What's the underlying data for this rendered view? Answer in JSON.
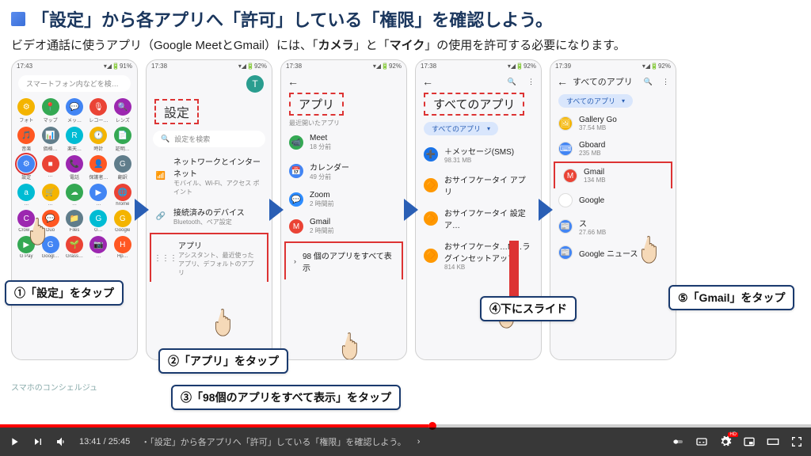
{
  "title": "「設定」から各アプリへ「許可」している「権限」を確認しよう。",
  "subtitle_pre": "ビデオ通話に使うアプリ（Google MeetとGmail）には、「",
  "subtitle_b1": "カメラ",
  "subtitle_mid": "」と「",
  "subtitle_b2": "マイク",
  "subtitle_post": "」の使用を許可する必要になります。",
  "callouts": {
    "c1": "①「設定」をタップ",
    "c2": "②「アプリ」をタップ",
    "c3": "③「98個のアプリをすべて表示」をタップ",
    "c4": "④下にスライド",
    "c5": "⑤「Gmail」をタップ"
  },
  "phone1": {
    "time": "17:43",
    "battery": "91%",
    "search_placeholder": "スマートフォン内などを検…",
    "apps": [
      {
        "i": "⚙",
        "l": "フォト"
      },
      {
        "i": "📍",
        "l": "マップ"
      },
      {
        "i": "💬",
        "l": "メッ…"
      },
      {
        "i": "🎙",
        "l": "レコー…"
      },
      {
        "i": "🔍",
        "l": "レンズ"
      },
      {
        "i": "🎵",
        "l": "音楽"
      },
      {
        "i": "📊",
        "l": "価格…"
      },
      {
        "i": "R",
        "l": "楽天…"
      },
      {
        "i": "🕐",
        "l": "時計"
      },
      {
        "i": "📄",
        "l": "証明…"
      },
      {
        "i": "⚙",
        "l": "設定"
      },
      {
        "i": "■",
        "l": "… "
      },
      {
        "i": "📞",
        "l": "電話"
      },
      {
        "i": "👤",
        "l": "保護者…"
      },
      {
        "i": "G",
        "l": "翻訳"
      },
      {
        "i": "a",
        "l": "… "
      },
      {
        "i": "🛒",
        "l": "…"
      },
      {
        "i": "☁",
        "l": "…"
      },
      {
        "i": "▶",
        "l": "…"
      },
      {
        "i": "🌐",
        "l": "hrome"
      },
      {
        "i": "C",
        "l": "Crow…"
      },
      {
        "i": "💬",
        "l": "Duo"
      },
      {
        "i": "📁",
        "l": "Files"
      },
      {
        "i": "G",
        "l": "G…"
      },
      {
        "i": "G",
        "l": "Google"
      },
      {
        "i": "▶",
        "l": "G Pay"
      },
      {
        "i": "G",
        "l": "Googl…"
      },
      {
        "i": "🌱",
        "l": "Grass…"
      },
      {
        "i": "📷",
        "l": "…"
      },
      {
        "i": "H",
        "l": "Hp…"
      }
    ]
  },
  "phone2": {
    "time": "17:38",
    "battery": "92%",
    "title": "設定",
    "search": "設定を検索",
    "items": [
      {
        "icon": "📶",
        "main": "ネットワークとインターネット",
        "sub": "モバイル、Wi-Fi、アクセス ポイント"
      },
      {
        "icon": "🔗",
        "main": "接続済みのデバイス",
        "sub": "Bluetooth、ペア設定"
      },
      {
        "icon": "⋮⋮⋮",
        "main": "アプリ",
        "sub": "アシスタント、最近使ったアプリ、デフォルトのアプリ"
      }
    ]
  },
  "phone3": {
    "time": "17:38",
    "battery": "92%",
    "title": "アプリ",
    "section": "最近開いたアプリ",
    "items": [
      {
        "icon": "📹",
        "bg": "#34a853",
        "main": "Meet",
        "sub": "18 分前"
      },
      {
        "icon": "📅",
        "bg": "#4285f4",
        "main": "カレンダー",
        "sub": "49 分前"
      },
      {
        "icon": "💬",
        "bg": "#2d8cff",
        "main": "Zoom",
        "sub": "2 時間前"
      },
      {
        "icon": "M",
        "bg": "#ea4335",
        "main": "Gmail",
        "sub": "2 時間前"
      }
    ],
    "showall": "98 個のアプリをすべて表示"
  },
  "phone4": {
    "time": "17:38",
    "battery": "92%",
    "title": "すべてのアプリ",
    "filter": "すべてのアプリ",
    "items": [
      {
        "icon": "➕",
        "bg": "#1a73e8",
        "main": "＋メッセージ(SMS)",
        "sub": "98.31 MB"
      },
      {
        "icon": "🔶",
        "bg": "#ff9800",
        "main": "おサイフケータイ アプリ",
        "sub": ""
      },
      {
        "icon": "🔶",
        "bg": "#ff9800",
        "main": "おサイフケータイ 設定ア…",
        "sub": ""
      },
      {
        "icon": "🔶",
        "bg": "#ff9800",
        "main": "おサイフケータ…M…ラグインセットアップ",
        "sub": "814 KB"
      }
    ]
  },
  "phone5": {
    "time": "17:39",
    "battery": "92%",
    "header": "すべてのアプリ",
    "filter": "すべてのアプリ",
    "items": [
      {
        "icon": "🖼",
        "bg": "#f4b400",
        "main": "Gallery Go",
        "sub": "37.54 MB"
      },
      {
        "icon": "⌨",
        "bg": "#4285f4",
        "main": "Gboard",
        "sub": "235 MB"
      },
      {
        "icon": "M",
        "bg": "#ea4335",
        "main": "Gmail",
        "sub": "134 MB"
      },
      {
        "icon": "G",
        "bg": "#fff",
        "main": "Google",
        "sub": ""
      },
      {
        "icon": "📰",
        "bg": "#4285f4",
        "main": "ス",
        "sub": "27.66 MB"
      },
      {
        "icon": "📰",
        "bg": "#4285f4",
        "main": "Google ニュース",
        "sub": ""
      }
    ]
  },
  "player": {
    "time": "13:41 / 25:45",
    "title": "・「設定」から各アプリへ「許可」している「権限」を確認しよう。",
    "brand": "スマホのコンシェルジュ"
  }
}
